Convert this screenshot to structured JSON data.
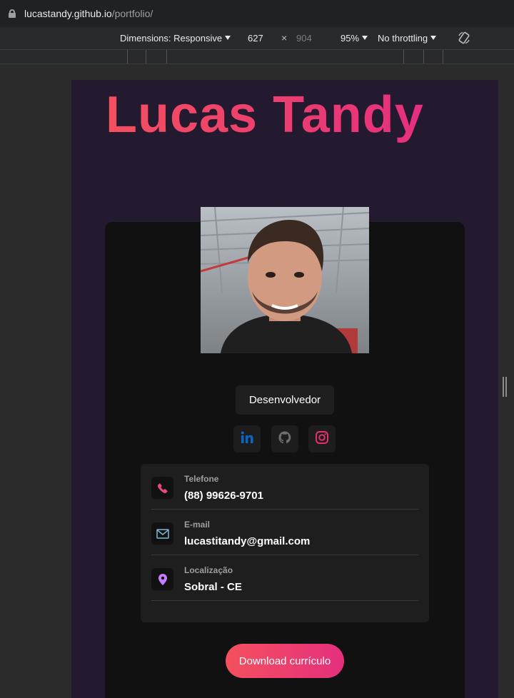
{
  "browser": {
    "url_host": "lucastandy.github.io",
    "url_path": "/portfolio/"
  },
  "devtools": {
    "dimensions_label": "Dimensions: Responsive",
    "width": "627",
    "times": "×",
    "height": "904",
    "zoom": "95%",
    "throttling": "No throttling",
    "rotate_icon": "rotate-icon"
  },
  "profile": {
    "name": "Lucas Tandy",
    "role": "Desenvolvedor",
    "photo_icon": "profile-photo"
  },
  "social": [
    {
      "name": "linkedin",
      "icon": "linkedin-icon",
      "color": "#0a66c2"
    },
    {
      "name": "github",
      "icon": "github-icon",
      "color": "#6e6e6e"
    },
    {
      "name": "instagram",
      "icon": "instagram-icon",
      "color": "#e1306c"
    }
  ],
  "contacts": [
    {
      "label": "Telefone",
      "value": "(88) 99626-9701",
      "icon": "phone-icon",
      "color": "#e84a7f"
    },
    {
      "label": "E-mail",
      "value": "lucastitandy@gmail.com",
      "icon": "mail-icon",
      "color": "#7fb8d8"
    },
    {
      "label": "Localização",
      "value": "Sobral - CE",
      "icon": "location-pin-icon",
      "color": "#c77dff"
    }
  ],
  "download_label": "Download currículo",
  "colors": {
    "accent_start": "#f4505e",
    "accent_end": "#e52f7e",
    "page_bg": "#241a30",
    "card_bg": "#111111"
  }
}
